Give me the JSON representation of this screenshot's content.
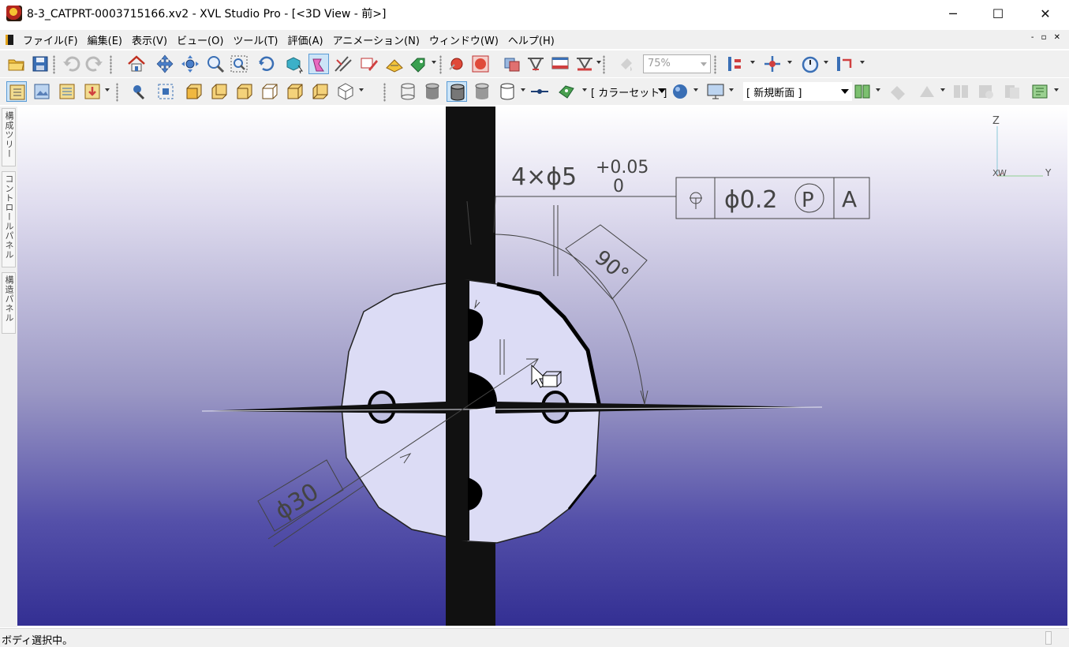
{
  "window": {
    "title": "8-3_CATPRT-0003715166.xv2 - XVL Studio Pro - [<3D View - 前>]",
    "minimize_glyph": "─",
    "maximize_glyph": "☐",
    "close_glyph": "✕"
  },
  "menu": {
    "items": [
      "ファイル(F)",
      "編集(E)",
      "表示(V)",
      "ビュー(O)",
      "ツール(T)",
      "評価(A)",
      "アニメーション(N)",
      "ウィンドウ(W)",
      "ヘルプ(H)"
    ],
    "mdi_controls": "- ▫ ✕"
  },
  "toolbar": {
    "zoom_value": "75%",
    "color_set_label": "[ カラーセット ]",
    "section_label": "[ 新規断面 ]"
  },
  "left_panel": {
    "tabs": [
      "構成ツリー",
      "コントロールパネル",
      "構造パネル"
    ]
  },
  "viewport": {
    "annotations": {
      "hole_callout": "4×ϕ5",
      "tol_upper": "+0.05",
      "tol_lower": "0",
      "fcf_symbol": "⌖",
      "fcf_tolerance": "ϕ0.2",
      "fcf_modifier": "P",
      "fcf_datum": "A",
      "angle": "90°",
      "diameter": "ϕ30"
    },
    "axes": {
      "z": "Z",
      "x": "X",
      "w": "W",
      "y": "Y"
    }
  },
  "status": {
    "text": "ボディ選択中。"
  },
  "colors": {
    "viewport_top": "#ffffff",
    "viewport_bottom": "#332f93",
    "part_face": "#dcdcf5",
    "part_edge": "#000000",
    "annotation": "#444444"
  }
}
